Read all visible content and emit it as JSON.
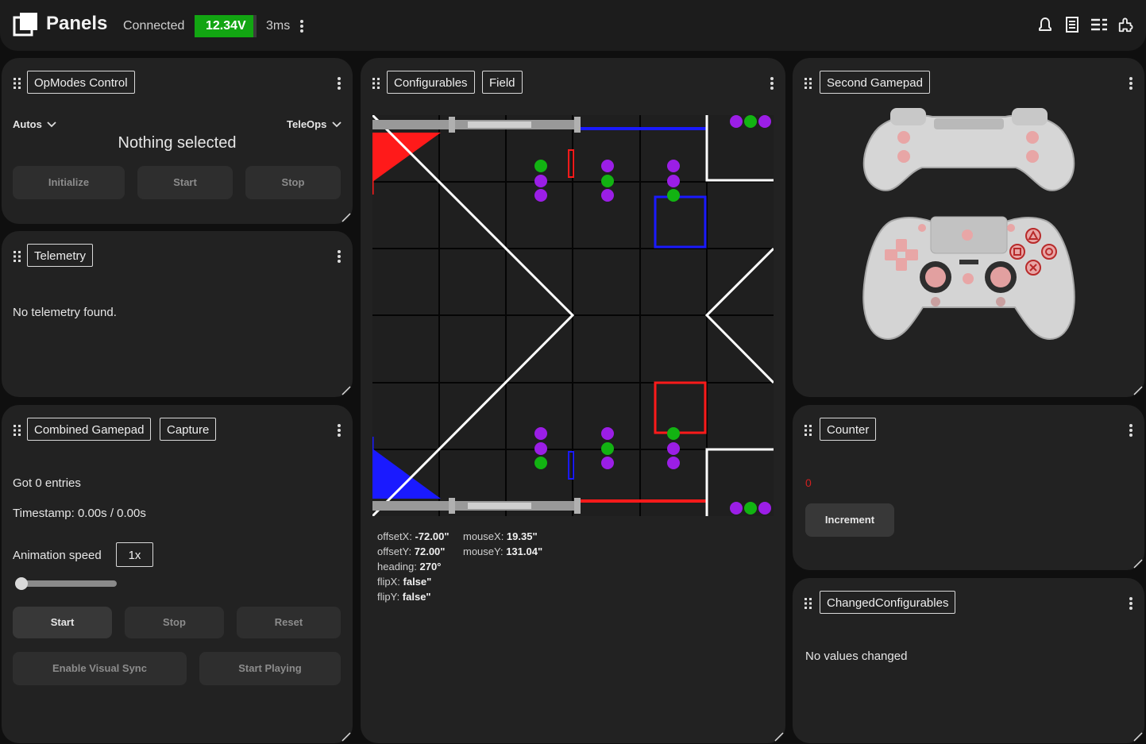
{
  "topbar": {
    "app_name": "Panels",
    "connection_status": "Connected",
    "battery_voltage": "12.34V",
    "battery_level": 0.95,
    "battery_color": "#12a512",
    "ping": "3ms",
    "icons": [
      "bell-icon",
      "document-icon",
      "list-icon",
      "plugin-icon"
    ]
  },
  "opmodes": {
    "tab_label": "OpModes Control",
    "autos_label": "Autos",
    "teleops_label": "TeleOps",
    "status": "Nothing selected",
    "init_label": "Initialize",
    "start_label": "Start",
    "stop_label": "Stop"
  },
  "telemetry": {
    "tab_label": "Telemetry",
    "message": "No telemetry found."
  },
  "combined_gamepad": {
    "tab_label": "Combined Gamepad",
    "capture_label": "Capture",
    "entries_text": "Got 0 entries",
    "timestamp_text": "Timestamp: 0.00s / 0.00s",
    "animation_speed_label": "Animation speed",
    "animation_speed_value": "1x",
    "slider_value": 0,
    "start_label": "Start",
    "stop_label": "Stop",
    "reset_label": "Reset",
    "visual_sync_label": "Enable Visual Sync",
    "start_playing_label": "Start Playing"
  },
  "field_panel": {
    "tab_configurables": "Configurables",
    "tab_field": "Field",
    "offsetX_label": "offsetX: ",
    "offsetX_value": "-72.00\"",
    "offsetY_label": "offsetY: ",
    "offsetY_value": "72.00\"",
    "heading_label": "heading: ",
    "heading_value": "270°",
    "flipX_label": "flipX: ",
    "flipX_value": "false\"",
    "flipY_label": "flipY: ",
    "flipY_value": "false\"",
    "mouseX_label": "mouseX: ",
    "mouseX_value": "19.35\"",
    "mouseY_label": "mouseY: ",
    "mouseY_value": "131.04\"",
    "colors": {
      "red": "#ff1a1a",
      "blue": "#1a1aff",
      "green": "#12b312",
      "purple": "#9b1ee6",
      "tile": "#1f1f1f",
      "line": "#ffffff"
    }
  },
  "second_gamepad": {
    "tab_label": "Second Gamepad"
  },
  "counter": {
    "tab_label": "Counter",
    "value": "0",
    "increment_label": "Increment",
    "value_color": "#d12020"
  },
  "changed_configurables": {
    "tab_label": "ChangedConfigurables",
    "message": "No values changed"
  }
}
